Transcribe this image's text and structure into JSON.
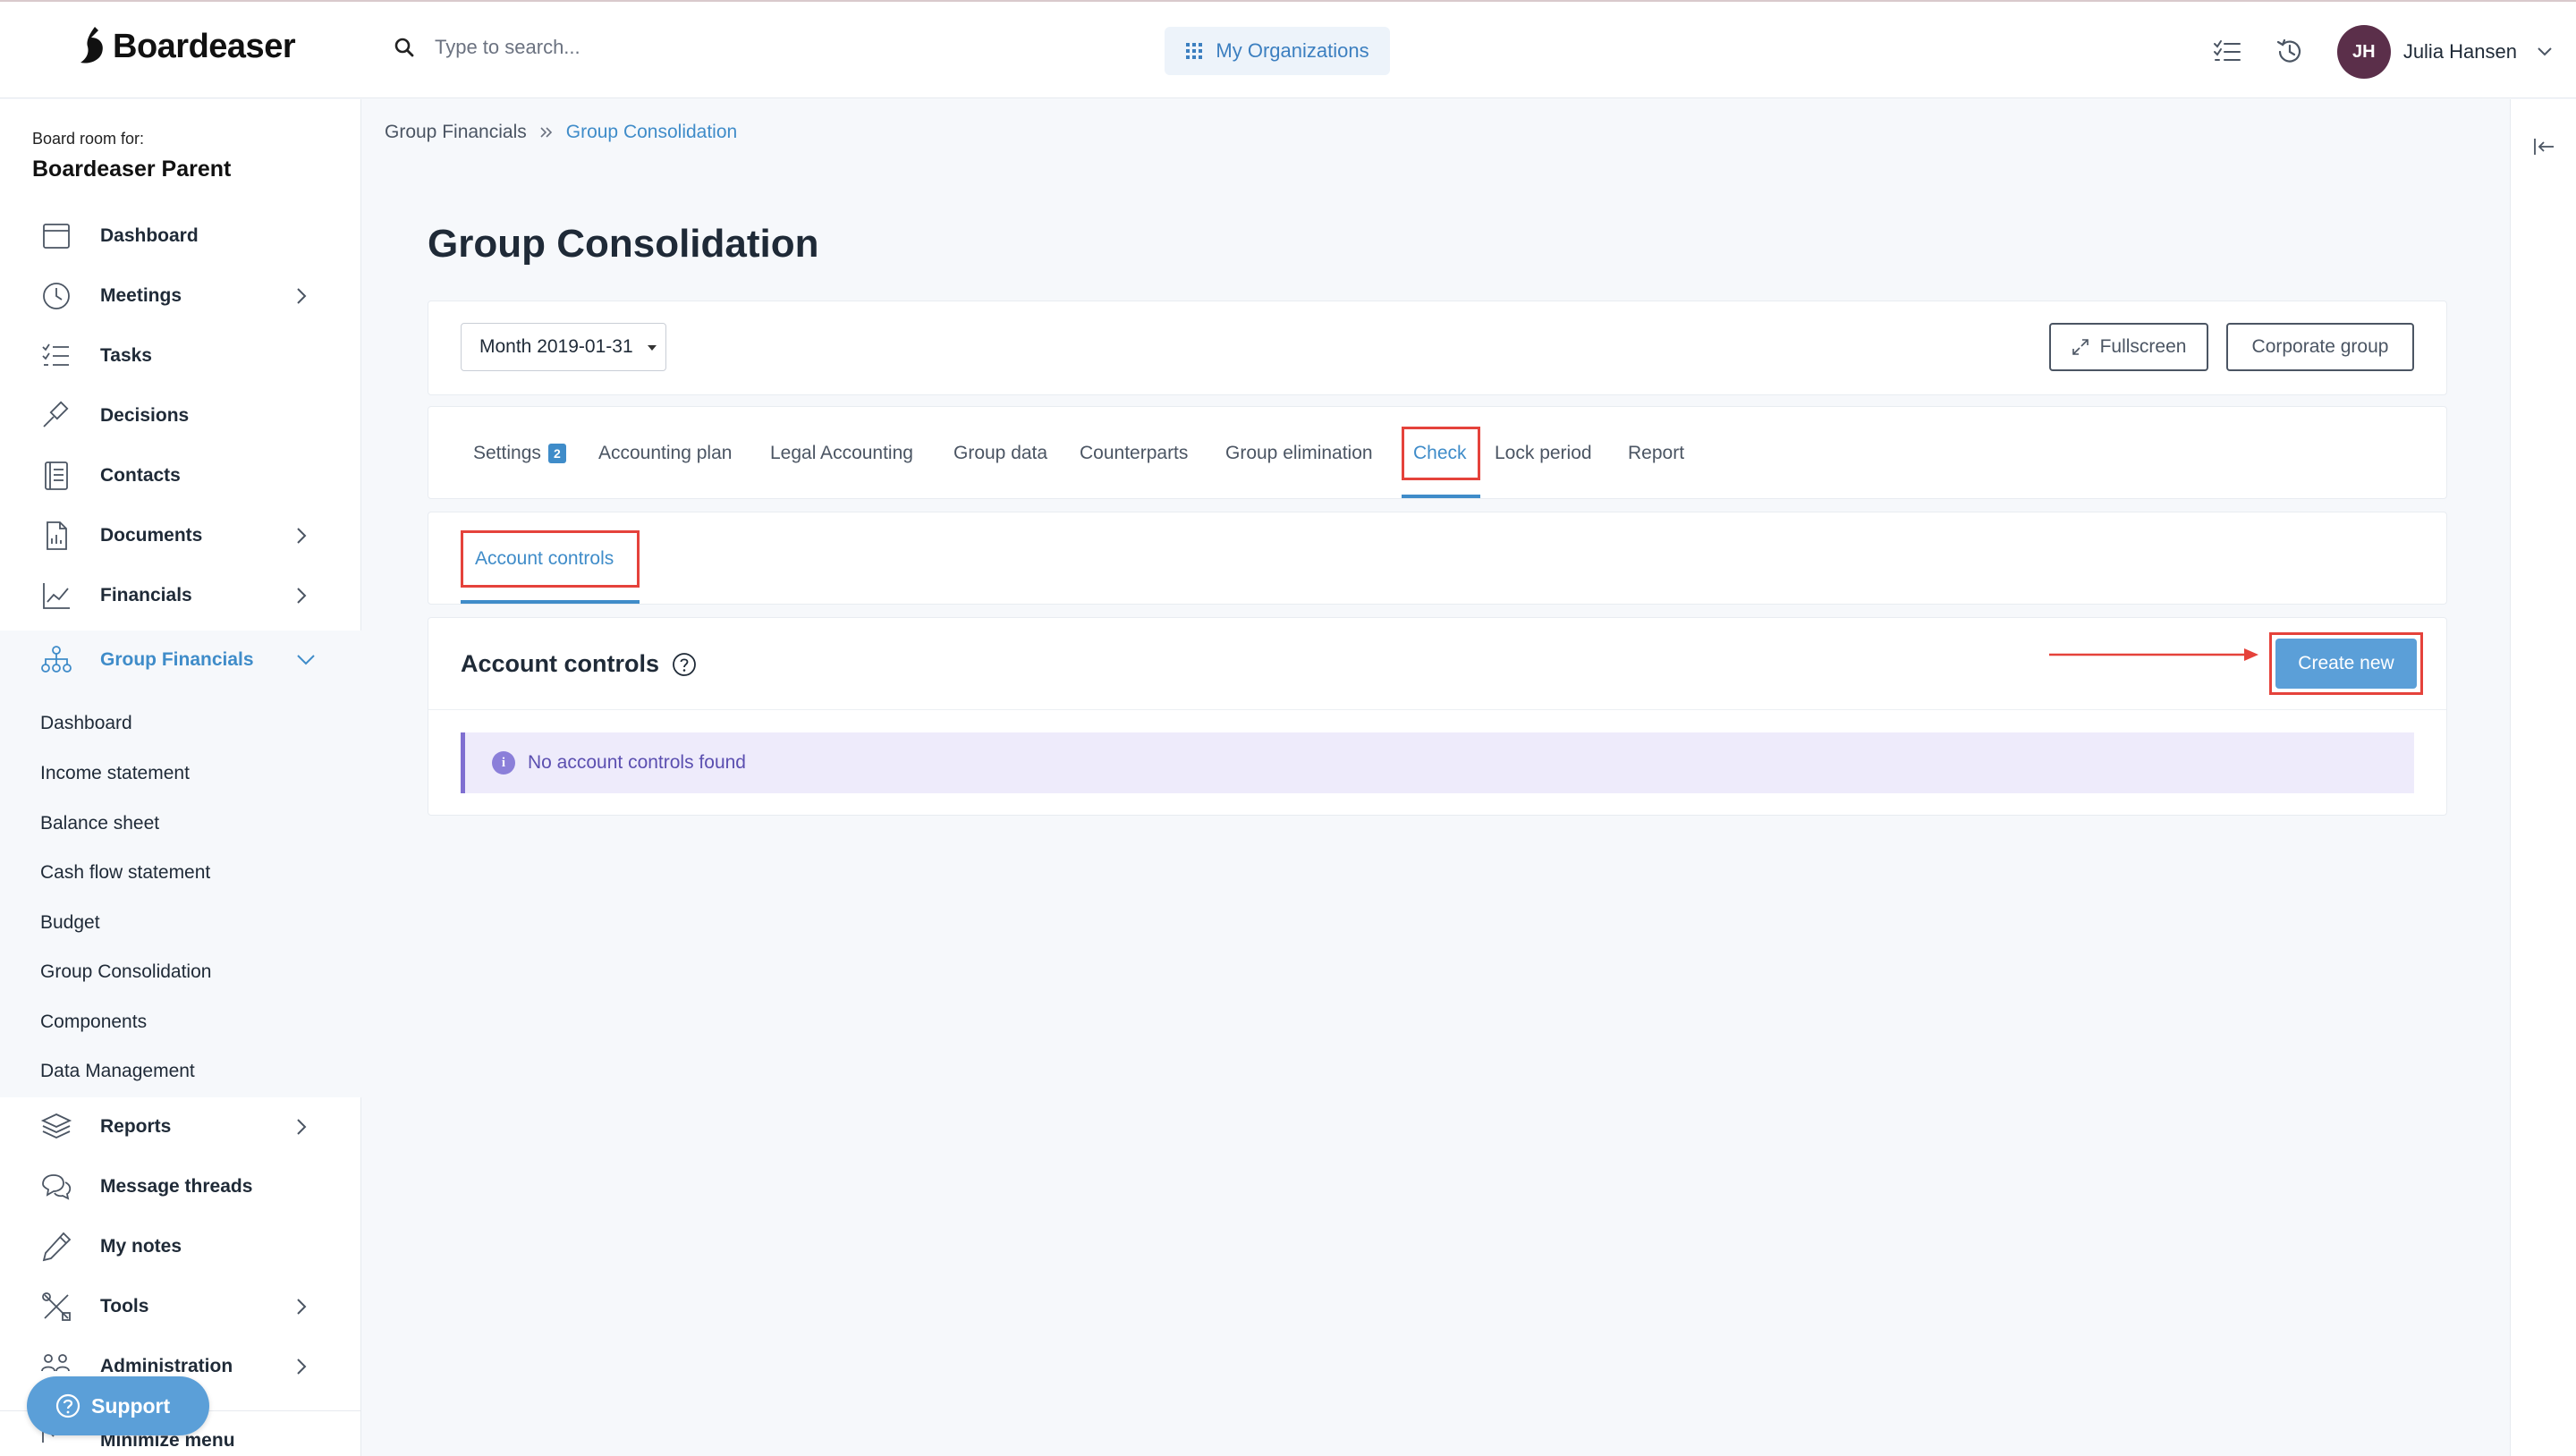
{
  "header": {
    "brand": "Boardeaser",
    "search_placeholder": "Type to search...",
    "organizations_label": "My Organizations",
    "user_initials": "JH",
    "user_name": "Julia Hansen"
  },
  "sidebar": {
    "board_label": "Board room for:",
    "board_name": "Boardeaser Parent",
    "items": [
      {
        "label": "Dashboard",
        "icon": "calendar-icon"
      },
      {
        "label": "Meetings",
        "icon": "clock-icon"
      },
      {
        "label": "Tasks",
        "icon": "checklist-icon"
      },
      {
        "label": "Decisions",
        "icon": "gavel-icon"
      },
      {
        "label": "Contacts",
        "icon": "address-book-icon"
      },
      {
        "label": "Documents",
        "icon": "document-icon"
      },
      {
        "label": "Financials",
        "icon": "chart-line-icon"
      },
      {
        "label": "Group Financials",
        "icon": "org-chart-icon"
      }
    ],
    "group_financials_sub": [
      "Dashboard",
      "Income statement",
      "Balance sheet",
      "Cash flow statement",
      "Budget",
      "Group Consolidation",
      "Components",
      "Data Management"
    ],
    "lower_items": [
      {
        "label": "Reports",
        "icon": "layers-icon"
      },
      {
        "label": "Message threads",
        "icon": "chat-icon"
      },
      {
        "label": "My notes",
        "icon": "pencil-icon"
      },
      {
        "label": "Tools",
        "icon": "tools-icon"
      },
      {
        "label": "Administration",
        "icon": "users-icon"
      },
      {
        "label": "Minimize menu",
        "icon": "collapse-icon"
      }
    ],
    "support_label": "Support"
  },
  "breadcrumb": {
    "parent": "Group Financials",
    "current": "Group Consolidation"
  },
  "page": {
    "title": "Group Consolidation",
    "month_select": "Month 2019-01-31",
    "fullscreen_label": "Fullscreen",
    "corporate_group_label": "Corporate group"
  },
  "tabs": {
    "settings": "Settings",
    "settings_badge": "2",
    "accounting_plan": "Accounting plan",
    "legal_accounting": "Legal Accounting",
    "group_data": "Group data",
    "counterparts": "Counterparts",
    "group_elimination": "Group elimination",
    "check": "Check",
    "lock_period": "Lock period",
    "report": "Report"
  },
  "subtabs": {
    "account_controls": "Account controls"
  },
  "controls": {
    "title": "Account controls",
    "create_new": "Create new",
    "empty_message": "No account controls found"
  },
  "colors": {
    "accent": "#3f8cc9",
    "button": "#5b9fd8",
    "highlight": "#e5423b",
    "info_bg": "#eeebfb"
  }
}
